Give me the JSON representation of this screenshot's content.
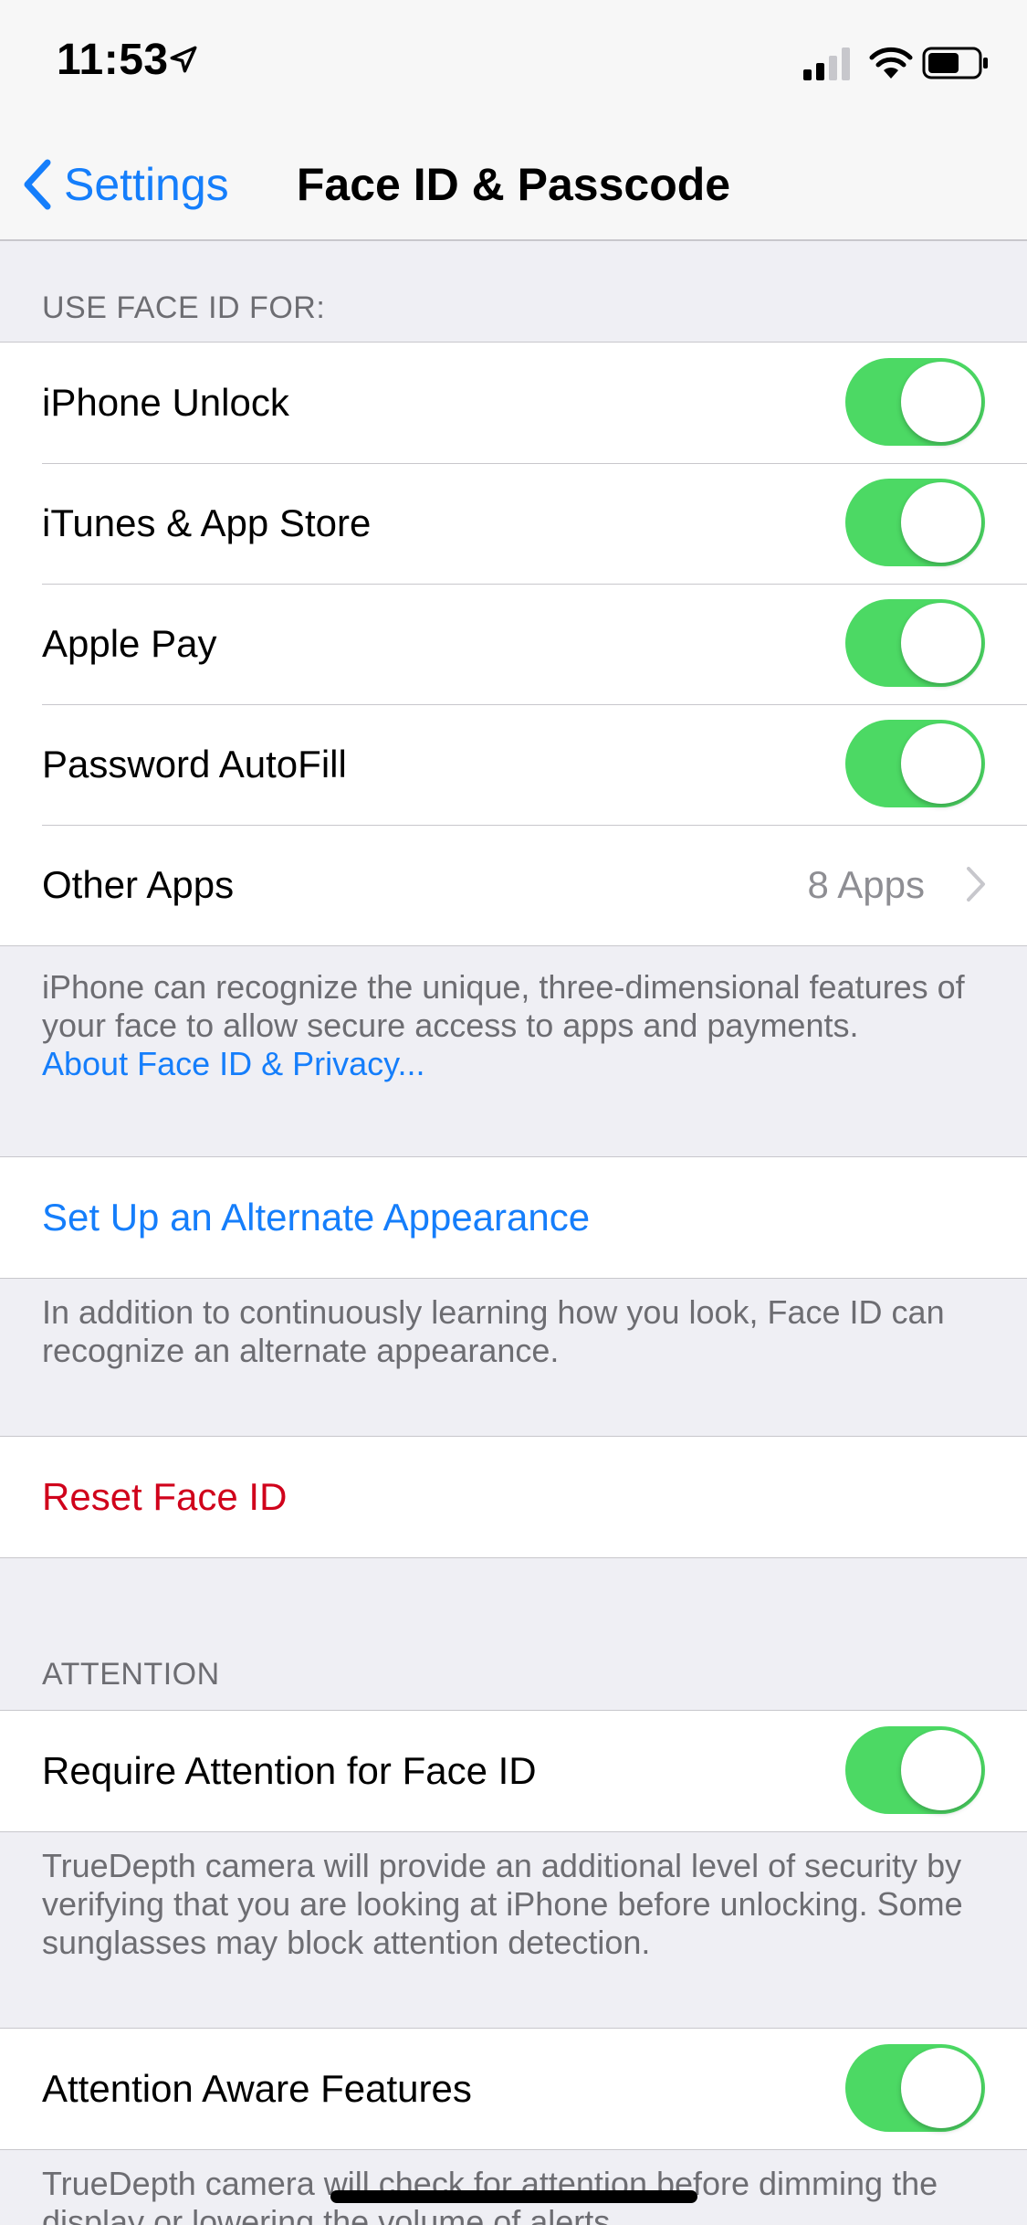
{
  "status_bar": {
    "time": "11:53",
    "icons": [
      "location-arrow-icon",
      "cellular-signal-icon",
      "wifi-icon",
      "battery-icon"
    ]
  },
  "nav": {
    "back_label": "Settings",
    "title": "Face ID & Passcode"
  },
  "use_face_id": {
    "header": "USE FACE ID FOR:",
    "rows": [
      {
        "label": "iPhone Unlock",
        "on": true
      },
      {
        "label": "iTunes & App Store",
        "on": true
      },
      {
        "label": "Apple Pay",
        "on": true
      },
      {
        "label": "Password AutoFill",
        "on": true
      }
    ],
    "other_apps": {
      "label": "Other Apps",
      "detail": "8 Apps"
    },
    "footer_text": "iPhone can recognize the unique, three-dimensional features of your face to allow secure access to apps and payments.",
    "footer_link": "About Face ID & Privacy..."
  },
  "alternate": {
    "label": "Set Up an Alternate Appearance",
    "footer": "In addition to continuously learning how you look, Face ID can recognize an alternate appearance."
  },
  "reset": {
    "label": "Reset Face ID"
  },
  "attention": {
    "header": "ATTENTION",
    "require_label": "Require Attention for Face ID",
    "require_on": true,
    "require_footer": "TrueDepth camera will provide an additional level of security by verifying that you are looking at iPhone before unlocking. Some sunglasses may block attention detection.",
    "aware_label": "Attention Aware Features",
    "aware_on": true,
    "aware_footer": "TrueDepth camera will check for attention before dimming the display or lowering the volume of alerts."
  },
  "colors": {
    "accent": "#157efb",
    "destructive": "#d0021b",
    "toggle_on": "#4cd964",
    "background": "#efeff4"
  }
}
